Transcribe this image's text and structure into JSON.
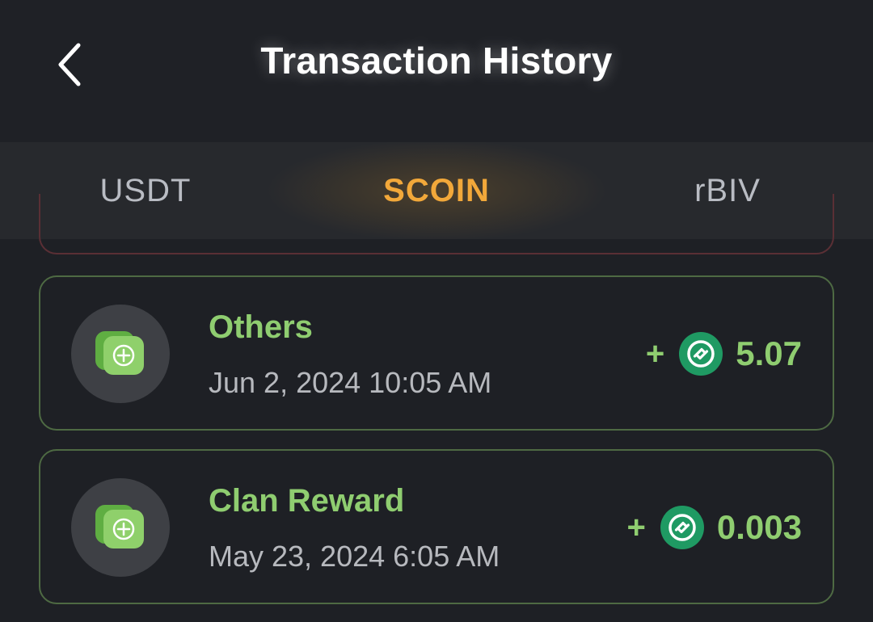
{
  "header": {
    "title": "Transaction History",
    "back_icon": "chevron-left-icon"
  },
  "tabs": [
    {
      "label": "USDT",
      "active": false
    },
    {
      "label": "SCOIN",
      "active": true
    },
    {
      "label": "rBIV",
      "active": false
    }
  ],
  "transactions": [
    {
      "title": "Others",
      "date": "Jun 2, 2024 10:05 AM",
      "sign": "+",
      "amount": "5.07",
      "icon": "plus-card-icon",
      "coin_icon": "scoin-icon"
    },
    {
      "title": "Clan Reward",
      "date": "May 23, 2024 6:05 AM",
      "sign": "+",
      "amount": "0.003",
      "icon": "plus-card-icon",
      "coin_icon": "scoin-icon"
    }
  ],
  "colors": {
    "background": "#1e2025",
    "tab_active": "#f2a83a",
    "income_green": "#8fcd70",
    "coin_green": "#1f9a63",
    "card_border": "#4e6a43"
  }
}
